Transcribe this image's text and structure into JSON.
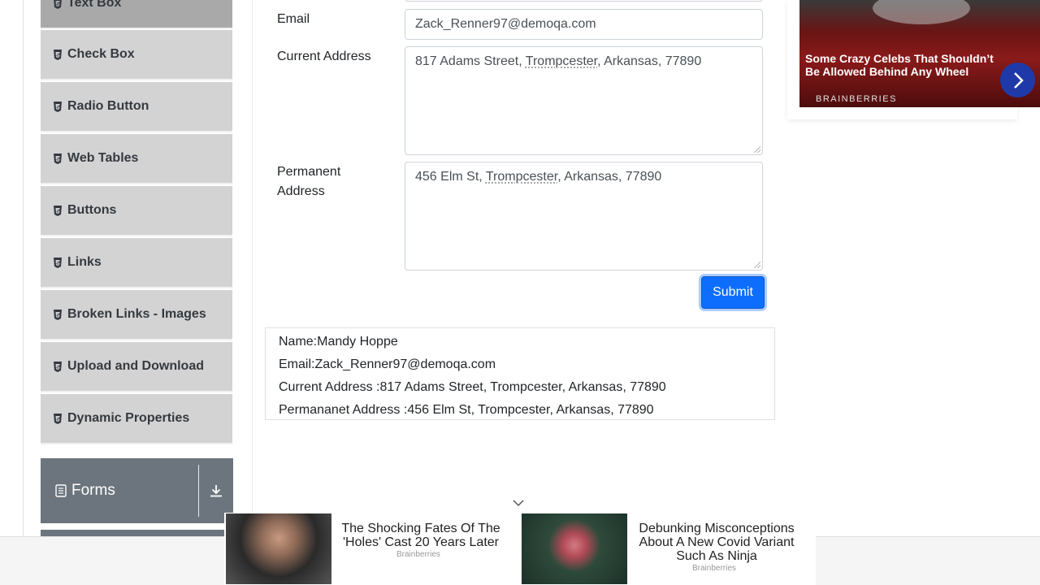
{
  "sidebar": {
    "items": [
      {
        "label": "Text Box",
        "active": true
      },
      {
        "label": "Check Box"
      },
      {
        "label": "Radio Button"
      },
      {
        "label": "Web Tables"
      },
      {
        "label": "Buttons"
      },
      {
        "label": "Links"
      },
      {
        "label": "Broken Links - Images"
      },
      {
        "label": "Upload and Download"
      },
      {
        "label": "Dynamic Properties"
      }
    ],
    "forms_group": {
      "label": "Forms",
      "icon": "document-icon",
      "expand_icon": "download-arrow-icon"
    }
  },
  "form": {
    "email_label": "Email",
    "email_value": "Zack_Renner97@demoqa.com",
    "current_address_label": "Current Address",
    "current_address_pre": "817 Adams Street, ",
    "current_address_spell": "Trompcester",
    "current_address_post": ", Arkansas, 77890",
    "permanent_address_label_1": "Permanent",
    "permanent_address_label_2": "Address",
    "permanent_address_pre": "456 Elm St, ",
    "permanent_address_spell": "Trompcester",
    "permanent_address_post": ", Arkansas, 77890",
    "submit_label": "Submit"
  },
  "output": {
    "name": "Name:Mandy Hoppe",
    "email": "Email:Zack_Renner97@demoqa.com",
    "current_address": "Current Address :817 Adams Street, Trompcester, Arkansas, 77890",
    "permanent_address": "Permananet Address :456 Elm St, Trompcester, Arkansas, 77890"
  },
  "ad_top": {
    "title": "Some Crazy Celebs That Shouldn’t Be Allowed Behind Any Wheel",
    "brand": "BRAINBERRIES"
  },
  "ad_bottom": {
    "card1_title": "The Shocking Fates Of The 'Holes' Cast 20 Years Later",
    "card1_source": "Brainberries",
    "card2_title": "Debunking Misconceptions About A New Covid Variant Such As Ninja",
    "card2_source": "Brainberries"
  },
  "colors": {
    "sidebar_item": "#d3d3d3",
    "sidebar_active": "#a9a9a9",
    "forms_group": "#6c757d",
    "submit": "#0d6efd"
  }
}
